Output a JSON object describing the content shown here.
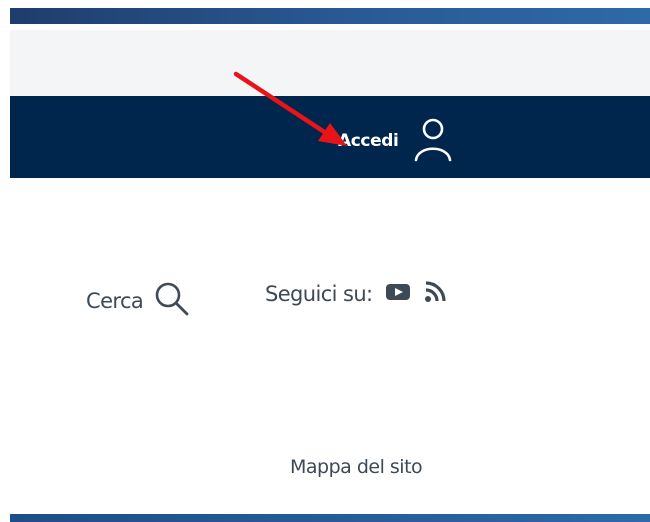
{
  "header": {
    "login_label": "Accedi",
    "login_icon": "user-icon"
  },
  "toolbar": {
    "search_label": "Cerca",
    "search_icon": "search-icon",
    "follow_label": "Seguici su:",
    "social": [
      {
        "icon": "youtube-icon"
      },
      {
        "icon": "rss-icon"
      }
    ]
  },
  "footer_nav": {
    "sitemap_label": "Mappa del sito"
  },
  "colors": {
    "navbar": "#00264d",
    "text": "#3d4a56",
    "annotation_arrow": "#e8141a"
  }
}
